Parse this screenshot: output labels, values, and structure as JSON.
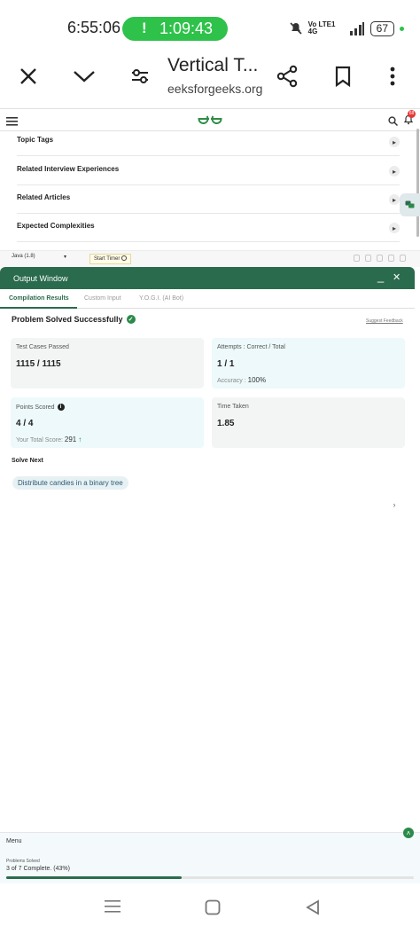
{
  "status_bar": {
    "time": "6:55:06",
    "call_timer": "1:09:43",
    "network": "Vo LTE1 4G",
    "battery": "67"
  },
  "browser": {
    "title": "Vertical T...",
    "url": "eeksforgeeks.org",
    "icons": [
      "close-icon",
      "chevron-down-icon",
      "tune-icon",
      "share-icon",
      "bookmark-icon",
      "more-vert-icon"
    ]
  },
  "site_header": {
    "logo": "GG",
    "notification_count": "68"
  },
  "accordion": [
    {
      "label": "Topic Tags"
    },
    {
      "label": "Related Interview Experiences"
    },
    {
      "label": "Related Articles"
    },
    {
      "label": "Expected Complexities"
    }
  ],
  "editor_toolbar": {
    "language": "Java (1.8)",
    "timer_label": "Start Timer"
  },
  "output_window": {
    "title": "Output Window",
    "minimize": "_",
    "close": "✕",
    "tabs": [
      {
        "label": "Compilation Results",
        "active": true
      },
      {
        "label": "Custom Input",
        "active": false
      },
      {
        "label": "Y.O.G.I. (AI Bot)",
        "active": false
      }
    ]
  },
  "result": {
    "status": "Problem Solved Successfully",
    "feedback_link": "Suggest Feedback",
    "cards": {
      "test_cases": {
        "title": "Test Cases Passed",
        "value": "1115 / 1115"
      },
      "attempts": {
        "title": "Attempts : Correct / Total",
        "value": "1 / 1",
        "sub_label": "Accuracy :",
        "sub_value": "100%"
      },
      "points": {
        "title": "Points Scored",
        "value": "4 / 4",
        "sub_label": "Your Total Score:",
        "sub_value": "291"
      },
      "time": {
        "title": "Time Taken",
        "value": "1.85"
      }
    },
    "solve_next_label": "Solve Next",
    "next_problem": "Distribute candies in a binary tree"
  },
  "menu": {
    "label": "Menu",
    "problems_solved_label": "Problems Solved",
    "progress_text": "3 of 7 Complete. (43%)",
    "progress_fraction": 0.43
  },
  "colors": {
    "brand_green": "#2b6b4d",
    "pill_green": "#2ec24a",
    "badge_red": "#e53935"
  }
}
